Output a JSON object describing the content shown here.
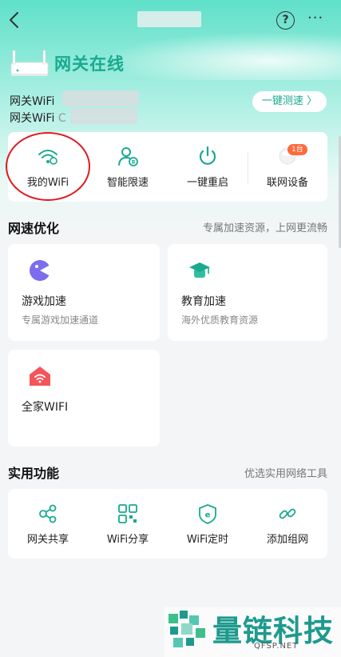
{
  "header": {
    "status_title": "网关在线",
    "wifi_label_1": "网关WiFi",
    "wifi_label_2": "网关WiFi",
    "wifi_value_2_prefix": "C",
    "speedtest_label": "一键测速 〉"
  },
  "quick_actions": [
    {
      "label": "我的WiFi",
      "icon": "wifi-icon"
    },
    {
      "label": "智能限速",
      "icon": "user-speed-icon"
    },
    {
      "label": "一键重启",
      "icon": "power-icon"
    },
    {
      "label": "联网设备",
      "icon": "device-icon",
      "badge": "1台"
    }
  ],
  "speed_section": {
    "title": "网速优化",
    "subtitle": "专属加速资源，上网更流畅",
    "cards": [
      {
        "name": "游戏加速",
        "desc": "专属游戏加速通道",
        "icon": "game-icon"
      },
      {
        "name": "教育加速",
        "desc": "海外优质教育资源",
        "icon": "education-icon"
      },
      {
        "name": "全家WIFI",
        "desc": "",
        "icon": "home-wifi-icon"
      }
    ]
  },
  "tools_section": {
    "title": "实用功能",
    "subtitle": "优选实用网络工具",
    "items": [
      {
        "label": "网关共享",
        "icon": "share-icon"
      },
      {
        "label": "WiFi分享",
        "icon": "qrcode-icon"
      },
      {
        "label": "WiFi定时",
        "icon": "shield-timer-icon"
      },
      {
        "label": "添加组网",
        "icon": "link-icon"
      }
    ]
  },
  "watermark": {
    "text": "量链科技",
    "sub": "QFSP.NET"
  },
  "colors": {
    "accent": "#1aa98f",
    "highlight_circle": "#e0191f",
    "badge": "#ff6a3d"
  }
}
